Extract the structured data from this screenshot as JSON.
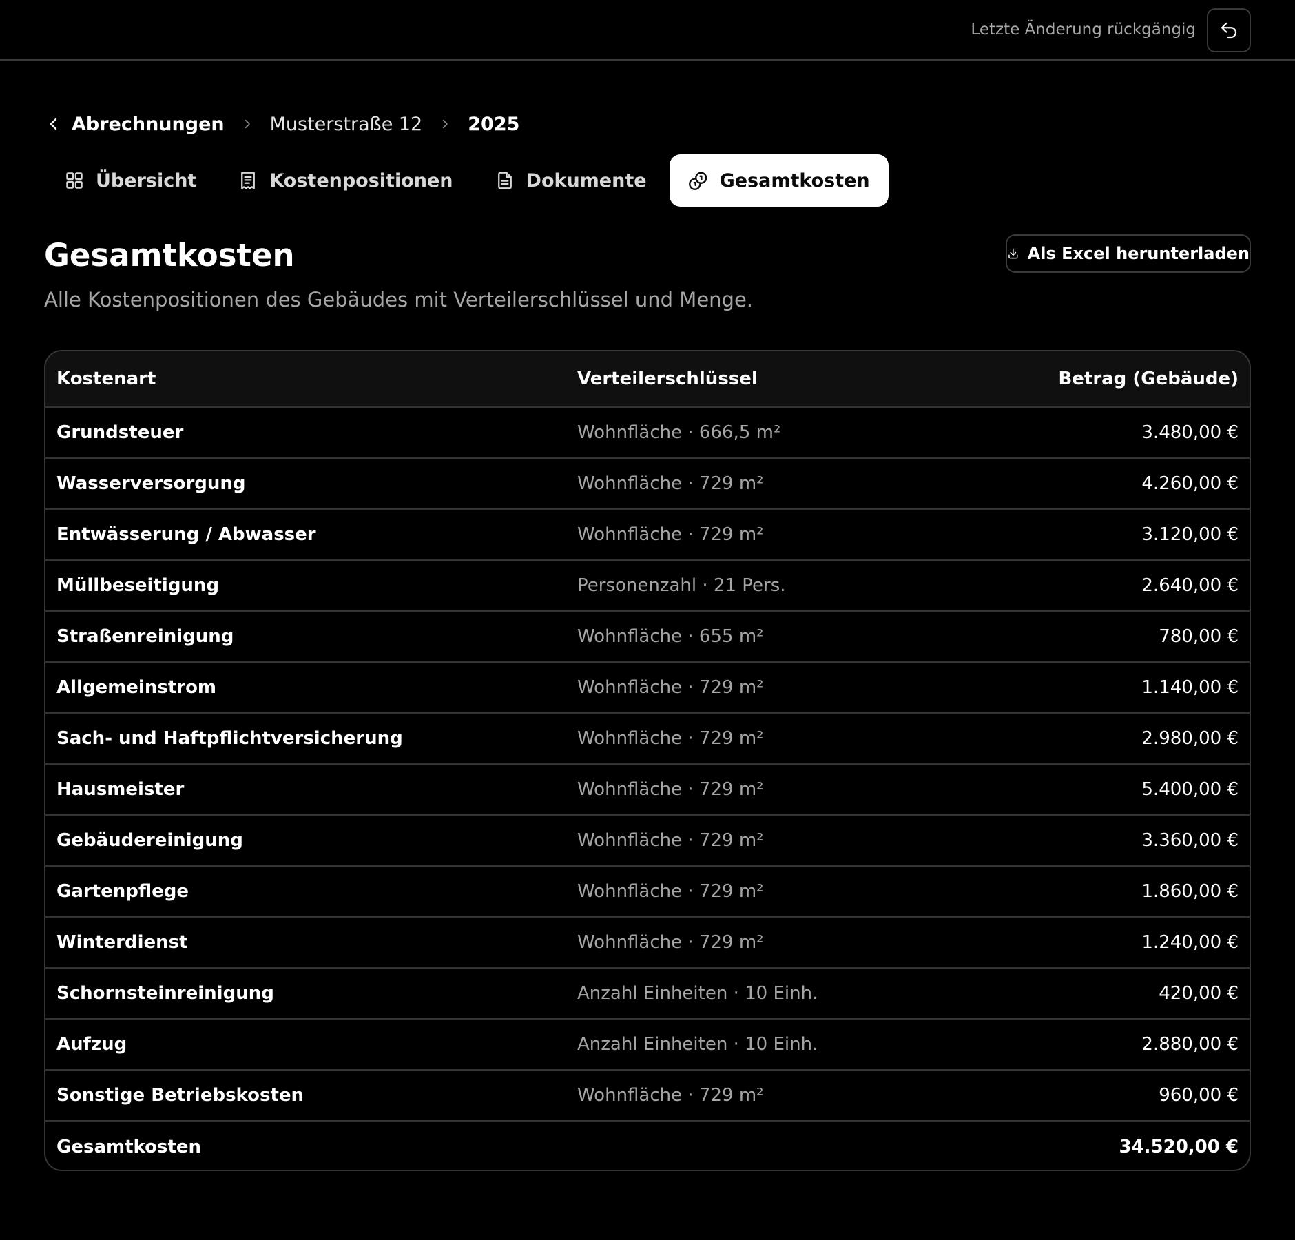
{
  "topbar": {
    "undo_label": "Letzte Änderung rückgängig",
    "undo_icon": "undo-icon"
  },
  "breadcrumb": {
    "back_label": "Abrechnungen",
    "property": "Musterstraße 12",
    "year": "2025"
  },
  "tabs": [
    {
      "label": "Übersicht",
      "icon": "grid-icon",
      "active": false
    },
    {
      "label": "Kostenpositionen",
      "icon": "receipt-icon",
      "active": false
    },
    {
      "label": "Dokumente",
      "icon": "document-icon",
      "active": false
    },
    {
      "label": "Gesamtkosten",
      "icon": "coins-icon",
      "active": true
    }
  ],
  "header": {
    "title": "Gesamtkosten",
    "subtitle": "Alle Kostenpositionen des Gebäudes mit Verteilerschlüssel und Menge.",
    "excel_button": "Als Excel herunterladen"
  },
  "table": {
    "columns": [
      "Kostenart",
      "Verteilerschlüssel",
      "Betrag (Gebäude)"
    ],
    "rows": [
      {
        "kostenart": "Grundsteuer",
        "schluessel": "Wohnfläche · 666,5 m²",
        "betrag": "3.480,00 €"
      },
      {
        "kostenart": "Wasserversorgung",
        "schluessel": "Wohnfläche · 729 m²",
        "betrag": "4.260,00 €"
      },
      {
        "kostenart": "Entwässerung / Abwasser",
        "schluessel": "Wohnfläche · 729 m²",
        "betrag": "3.120,00 €"
      },
      {
        "kostenart": "Müllbeseitigung",
        "schluessel": "Personenzahl · 21 Pers.",
        "betrag": "2.640,00 €"
      },
      {
        "kostenart": "Straßenreinigung",
        "schluessel": "Wohnfläche · 655 m²",
        "betrag": "780,00 €"
      },
      {
        "kostenart": "Allgemeinstrom",
        "schluessel": "Wohnfläche · 729 m²",
        "betrag": "1.140,00 €"
      },
      {
        "kostenart": "Sach- und Haftpflichtversicherung",
        "schluessel": "Wohnfläche · 729 m²",
        "betrag": "2.980,00 €"
      },
      {
        "kostenart": "Hausmeister",
        "schluessel": "Wohnfläche · 729 m²",
        "betrag": "5.400,00 €"
      },
      {
        "kostenart": "Gebäudereinigung",
        "schluessel": "Wohnfläche · 729 m²",
        "betrag": "3.360,00 €"
      },
      {
        "kostenart": "Gartenpflege",
        "schluessel": "Wohnfläche · 729 m²",
        "betrag": "1.860,00 €"
      },
      {
        "kostenart": "Winterdienst",
        "schluessel": "Wohnfläche · 729 m²",
        "betrag": "1.240,00 €"
      },
      {
        "kostenart": "Schornsteinreinigung",
        "schluessel": "Anzahl Einheiten · 10 Einh.",
        "betrag": "420,00 €"
      },
      {
        "kostenart": "Aufzug",
        "schluessel": "Anzahl Einheiten · 10 Einh.",
        "betrag": "2.880,00 €"
      },
      {
        "kostenart": "Sonstige Betriebskosten",
        "schluessel": "Wohnfläche · 729 m²",
        "betrag": "960,00 €"
      }
    ],
    "total": {
      "label": "Gesamtkosten",
      "betrag": "34.520,00 €"
    }
  },
  "colors": {
    "background": "#000000",
    "active_tab_bg": "#ffffff",
    "muted_text": "#a4a4a4",
    "border": "#363636"
  }
}
